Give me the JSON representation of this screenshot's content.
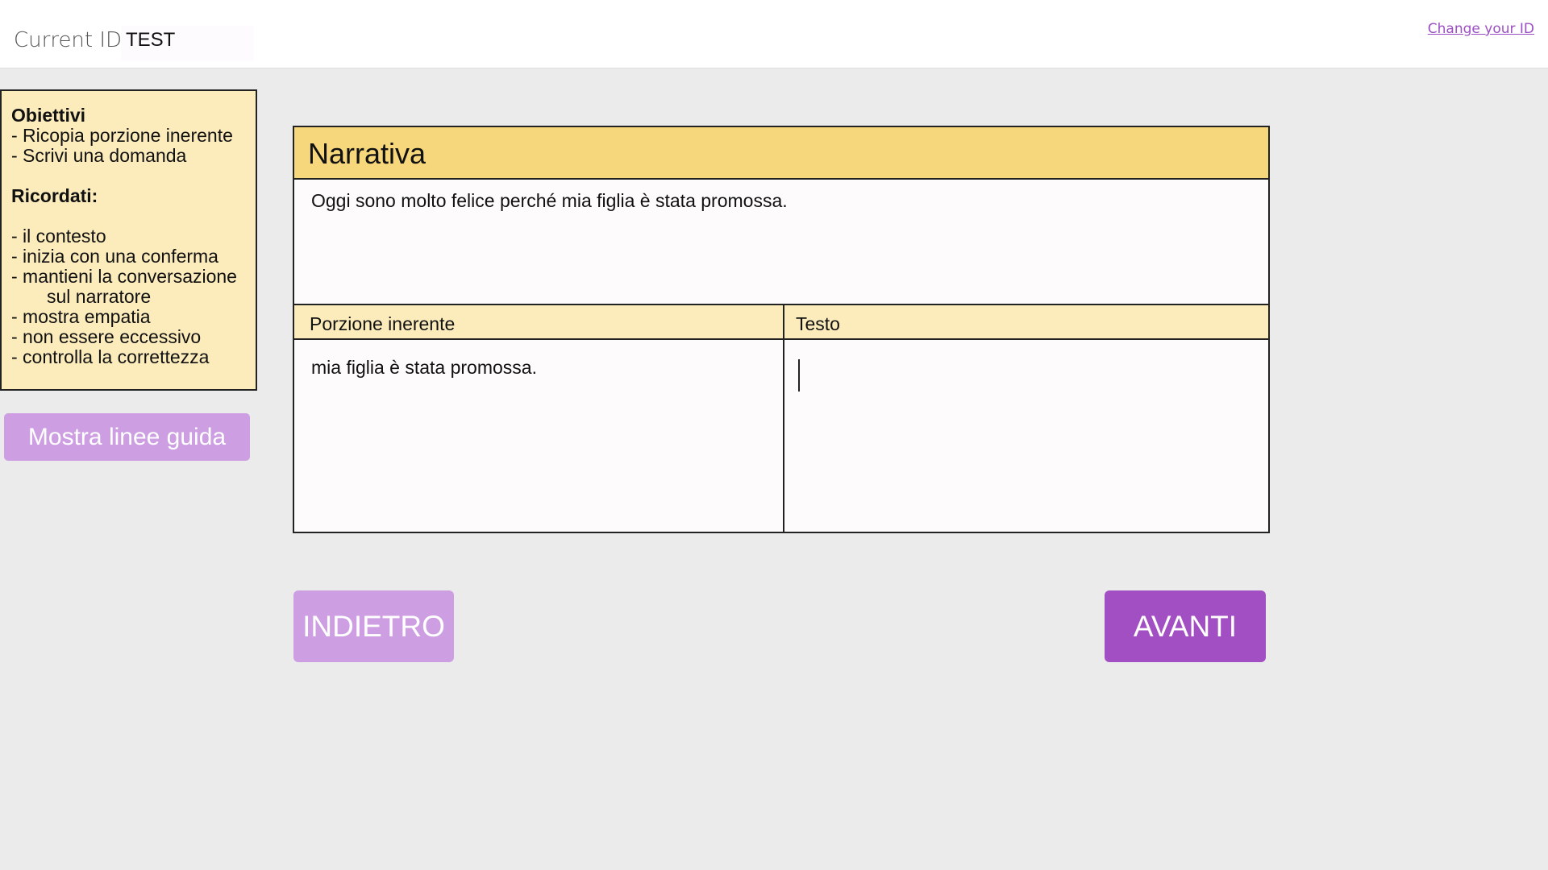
{
  "header": {
    "current_id_label": "Current ID:",
    "current_id_value": "TEST",
    "change_id_link": "Change your ID"
  },
  "guide": {
    "objectives_heading": "Obiettivi",
    "objectives": [
      "- Ricopia porzione inerente",
      "- Scrivi una domanda"
    ],
    "remember_heading": "Ricordati:",
    "remember_items": [
      "- il contesto",
      "- inizia con una conferma",
      "- mantieni la conversazione",
      "sul narratore",
      "- mostra empatia",
      "- non essere eccessivo",
      "- controlla la correttezza"
    ]
  },
  "show_guidelines_button": "Mostra linee guida",
  "panel": {
    "title": "Narrativa",
    "narrative_text": "Oggi sono molto felice perché mia figlia è stata promossa.",
    "column_left_header": "Porzione inerente",
    "column_right_header": "Testo",
    "cell_left_value": "mia figlia è stata promossa.",
    "cell_right_value": ""
  },
  "navigation": {
    "back_label": "INDIETRO",
    "next_label": "AVANTI"
  },
  "colors": {
    "background": "#ebebeb",
    "panel_title_bg": "#f6d77b",
    "note_bg": "#fcebbb",
    "accent_light": "#cd9fe2",
    "accent_dark": "#a34fc4",
    "link": "#9c4fc4"
  }
}
